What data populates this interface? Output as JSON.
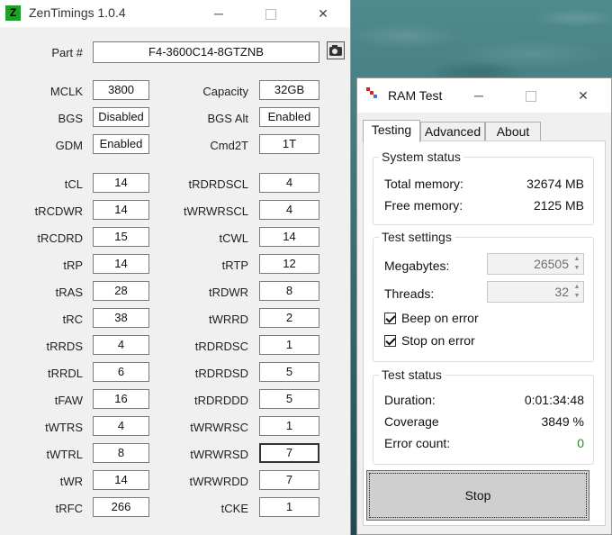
{
  "zen": {
    "title": "ZenTimings 1.0.4",
    "logo_letter": "Z",
    "part_label": "Part #",
    "part_value": "F4-3600C14-8GTZNB",
    "top_rows": [
      {
        "left_label": "MCLK",
        "left_value": "3800",
        "right_label": "Capacity",
        "right_value": "32GB"
      },
      {
        "left_label": "BGS",
        "left_value": "Disabled",
        "right_label": "BGS Alt",
        "right_value": "Enabled"
      },
      {
        "left_label": "GDM",
        "left_value": "Enabled",
        "right_label": "Cmd2T",
        "right_value": "1T"
      }
    ],
    "timings": [
      {
        "left_label": "tCL",
        "left_value": "14",
        "right_label": "tRDRDSCL",
        "right_value": "4"
      },
      {
        "left_label": "tRCDWR",
        "left_value": "14",
        "right_label": "tWRWRSCL",
        "right_value": "4"
      },
      {
        "left_label": "tRCDRD",
        "left_value": "15",
        "right_label": "tCWL",
        "right_value": "14"
      },
      {
        "left_label": "tRP",
        "left_value": "14",
        "right_label": "tRTP",
        "right_value": "12"
      },
      {
        "left_label": "tRAS",
        "left_value": "28",
        "right_label": "tRDWR",
        "right_value": "8"
      },
      {
        "left_label": "tRC",
        "left_value": "38",
        "right_label": "tWRRD",
        "right_value": "2"
      },
      {
        "left_label": "tRRDS",
        "left_value": "4",
        "right_label": "tRDRDSC",
        "right_value": "1"
      },
      {
        "left_label": "tRRDL",
        "left_value": "6",
        "right_label": "tRDRDSD",
        "right_value": "5"
      },
      {
        "left_label": "tFAW",
        "left_value": "16",
        "right_label": "tRDRDDD",
        "right_value": "5"
      },
      {
        "left_label": "tWTRS",
        "left_value": "4",
        "right_label": "tWRWRSC",
        "right_value": "1"
      },
      {
        "left_label": "tWTRL",
        "left_value": "8",
        "right_label": "tWRWRSD",
        "right_value": "7"
      },
      {
        "left_label": "tWR",
        "left_value": "14",
        "right_label": "tWRWRDD",
        "right_value": "7"
      },
      {
        "left_label": "tRFC",
        "left_value": "266",
        "right_label": "tCKE",
        "right_value": "1"
      }
    ]
  },
  "ramtest": {
    "title": "RAM Test",
    "tabs": [
      "Testing",
      "Advanced",
      "About"
    ],
    "system_status": {
      "title": "System status",
      "total_label": "Total memory:",
      "total_value": "32674 MB",
      "free_label": "Free memory:",
      "free_value": "2125 MB"
    },
    "test_settings": {
      "title": "Test settings",
      "megabytes_label": "Megabytes:",
      "megabytes_value": "26505",
      "threads_label": "Threads:",
      "threads_value": "32",
      "beep_label": "Beep on error",
      "beep_checked": true,
      "stop_label": "Stop on error",
      "stop_checked": true
    },
    "test_status": {
      "title": "Test status",
      "duration_label": "Duration:",
      "duration_value": "0:01:34:48",
      "coverage_label": "Coverage",
      "coverage_value": "3849 %",
      "errors_label": "Error count:",
      "errors_value": "0"
    },
    "stop_button": "Stop"
  },
  "icons": {
    "minimize": "─",
    "close": "✕",
    "spin_up": "▲",
    "spin_down": "▼"
  }
}
